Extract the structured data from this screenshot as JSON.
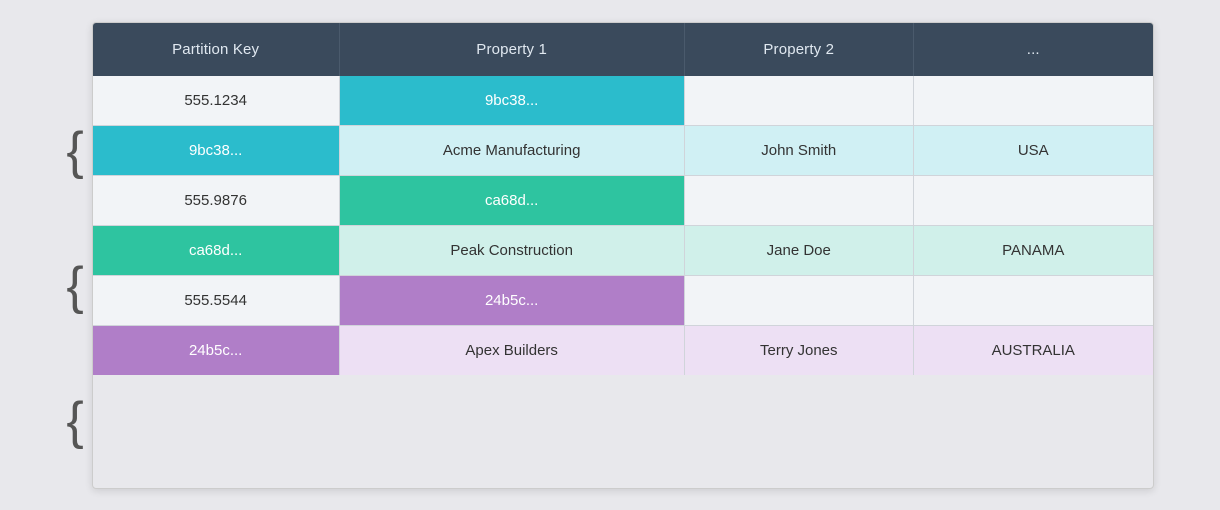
{
  "header": {
    "col1": "Partition Key",
    "col2": "Property 1",
    "col3": "Property 2",
    "col4": "..."
  },
  "rows": [
    {
      "id": "row1",
      "type": "light",
      "cells": [
        "555.1234",
        "9bc38...",
        "",
        ""
      ],
      "cell_colors": [
        "normal",
        "teal",
        "normal",
        "normal"
      ]
    },
    {
      "id": "row2",
      "type": "teal",
      "cells": [
        "9bc38...",
        "Acme Manufacturing",
        "John Smith",
        "USA"
      ],
      "cell_colors": [
        "teal",
        "normal",
        "normal",
        "normal"
      ]
    },
    {
      "id": "row3",
      "type": "light",
      "cells": [
        "555.9876",
        "ca68d...",
        "",
        ""
      ],
      "cell_colors": [
        "normal",
        "mint",
        "normal",
        "normal"
      ]
    },
    {
      "id": "row4",
      "type": "mint",
      "cells": [
        "ca68d...",
        "Peak Construction",
        "Jane Doe",
        "PANAMA"
      ],
      "cell_colors": [
        "mint",
        "normal",
        "normal",
        "normal"
      ]
    },
    {
      "id": "row5",
      "type": "light",
      "cells": [
        "555.5544",
        "24b5c...",
        "",
        ""
      ],
      "cell_colors": [
        "normal",
        "purple",
        "normal",
        "normal"
      ]
    },
    {
      "id": "row6",
      "type": "purple",
      "cells": [
        "24b5c...",
        "Apex Builders",
        "Terry Jones",
        "AUSTRALIA"
      ],
      "cell_colors": [
        "purple",
        "normal",
        "normal",
        "normal"
      ]
    }
  ],
  "braces": [
    "{",
    "{",
    "{"
  ]
}
